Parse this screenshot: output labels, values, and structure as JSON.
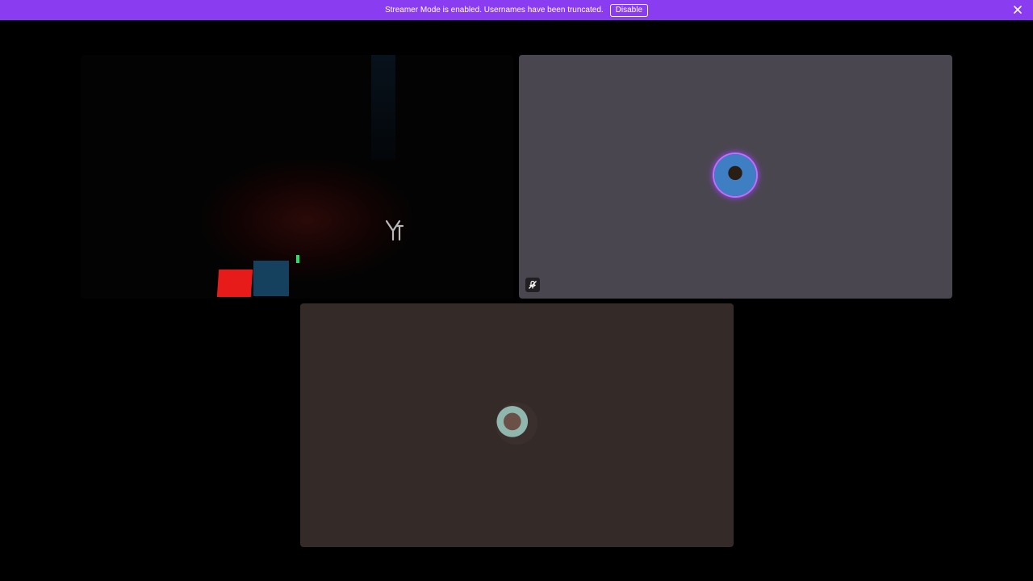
{
  "notice": {
    "text": "Streamer Mode is enabled. Usernames have been truncated.",
    "disable_label": "Disable",
    "color": "#8a3cf0"
  },
  "tiles": [
    {
      "kind": "video",
      "background": "#030303"
    },
    {
      "kind": "avatar",
      "background": "#4a4650",
      "speaking": true,
      "muted": true,
      "icon": "mute-icon"
    },
    {
      "kind": "avatar",
      "background": "#342b29",
      "speaking": false
    }
  ],
  "icons": {
    "close": "close-icon",
    "mute": "mute-icon"
  }
}
